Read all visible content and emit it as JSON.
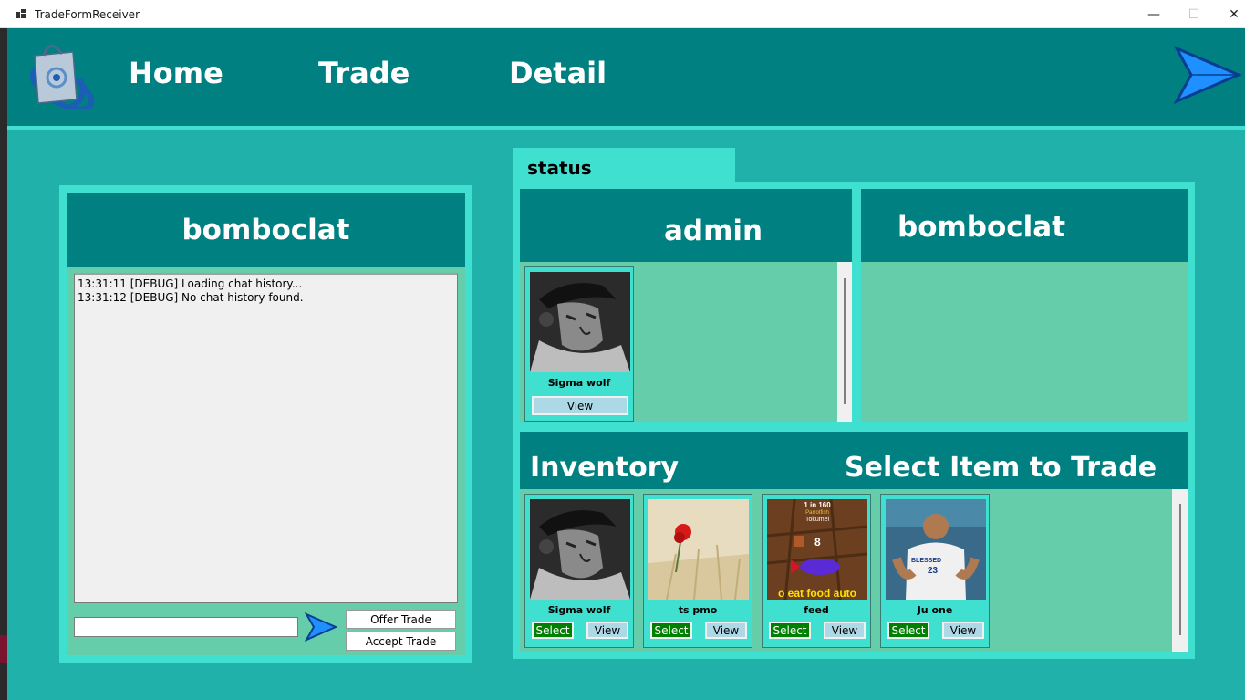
{
  "window": {
    "title": "TradeFormReceiver",
    "minimize": "—",
    "maximize": "☐",
    "close": "✕"
  },
  "nav": {
    "home": "Home",
    "trade": "Trade",
    "detail": "Detail"
  },
  "chat": {
    "title": "bomboclat",
    "log": [
      "13:31:11 [DEBUG] Loading chat history...",
      "13:31:12 [DEBUG] No chat history found."
    ],
    "input_value": "",
    "offer_label": "Offer Trade",
    "accept_label": "Accept Trade"
  },
  "status_label": "status",
  "admin_box": {
    "title": "admin",
    "items": [
      {
        "name": "Sigma wolf",
        "view": "View"
      }
    ]
  },
  "other_box": {
    "title": "bomboclat"
  },
  "inventory": {
    "title": "Inventory",
    "hint": "Select Item to Trade",
    "items": [
      {
        "name": "Sigma wolf",
        "select": "Select",
        "view": "View"
      },
      {
        "name": "ts pmo",
        "select": "Select",
        "view": "View"
      },
      {
        "name": "feed",
        "select": "Select",
        "view": "View"
      },
      {
        "name": "Ju one",
        "select": "Select",
        "view": "View"
      }
    ],
    "feed_overlay": {
      "top": "1 in 160",
      "tag": "Parrotfish",
      "sub": "Tokumei",
      "count": "8",
      "caption": "o eat food auto"
    },
    "shirt_text": {
      "brand": "BLESSED",
      "number": "23"
    }
  },
  "colors": {
    "teal_dark": "#008080",
    "turquoise": "#40e0d0",
    "aquamarine": "#66cdaa",
    "bg": "#20b2aa",
    "select_green": "#008000",
    "view_blue": "#add8e6"
  }
}
